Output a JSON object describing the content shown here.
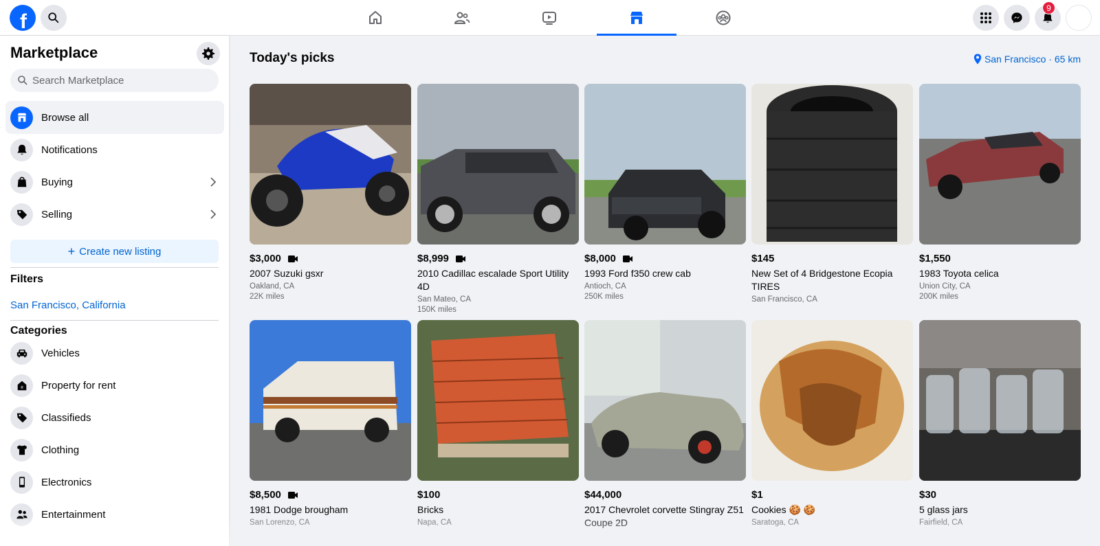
{
  "header": {
    "logo": "f",
    "nav_tabs": [
      {
        "name": "home-icon",
        "active": false
      },
      {
        "name": "friends-icon",
        "active": false
      },
      {
        "name": "video-icon",
        "active": false
      },
      {
        "name": "marketplace-icon",
        "active": true
      },
      {
        "name": "groups-icon",
        "active": false
      }
    ],
    "notification_count": "9",
    "accent_color": "#0866ff"
  },
  "sidebar": {
    "title": "Marketplace",
    "search_placeholder": "Search Marketplace",
    "nav": [
      {
        "label": "Browse all",
        "icon": "storefront-icon",
        "active": true
      },
      {
        "label": "Notifications",
        "icon": "bell-icon"
      },
      {
        "label": "Buying",
        "icon": "shopping-bag-icon",
        "chevron": true
      },
      {
        "label": "Selling",
        "icon": "tag-icon",
        "chevron": true
      }
    ],
    "create_listing": "Create new listing",
    "filters_heading": "Filters",
    "filter_location": "San Francisco, California",
    "categories_heading": "Categories",
    "categories": [
      {
        "label": "Vehicles",
        "icon": "car-icon"
      },
      {
        "label": "Property for rent",
        "icon": "house-icon"
      },
      {
        "label": "Classifieds",
        "icon": "tag-icon"
      },
      {
        "label": "Clothing",
        "icon": "shirt-icon"
      },
      {
        "label": "Electronics",
        "icon": "phone-icon"
      },
      {
        "label": "Entertainment",
        "icon": "people-icon"
      }
    ]
  },
  "feed": {
    "title": "Today's picks",
    "location": "San Francisco · 65 km",
    "listings": [
      {
        "price": "$3,000",
        "video": true,
        "title": "2007 Suzuki gsxr",
        "location": "Oakland, CA",
        "miles": "22K miles"
      },
      {
        "price": "$8,999",
        "video": true,
        "title": "2010 Cadillac escalade Sport Utility 4D",
        "location": "San Mateo, CA",
        "miles": "150K miles"
      },
      {
        "price": "$8,000",
        "video": true,
        "title": "1993 Ford f350 crew cab",
        "location": "Antioch, CA",
        "miles": "250K miles"
      },
      {
        "price": "$145",
        "video": false,
        "title": "New Set of 4 Bridgestone Ecopia TIRES",
        "location": "San Francisco, CA",
        "miles": ""
      },
      {
        "price": "$1,550",
        "video": false,
        "title": "1983 Toyota celica",
        "location": "Union City, CA",
        "miles": "200K miles"
      },
      {
        "price": "$8,500",
        "video": true,
        "title": "1981 Dodge brougham",
        "location": "San Lorenzo, CA",
        "miles": ""
      },
      {
        "price": "$100",
        "video": false,
        "title": "Bricks",
        "location": "Napa, CA",
        "miles": ""
      },
      {
        "price": "$44,000",
        "video": false,
        "title": "2017 Chevrolet corvette Stingray Z51 Coupe 2D",
        "location": "",
        "miles": ""
      },
      {
        "price": "$1",
        "video": false,
        "title": "Cookies 🍪 🍪",
        "location": "Saratoga, CA",
        "miles": ""
      },
      {
        "price": "$30",
        "video": false,
        "title": "5 glass jars",
        "location": "Fairfield, CA",
        "miles": ""
      }
    ]
  }
}
